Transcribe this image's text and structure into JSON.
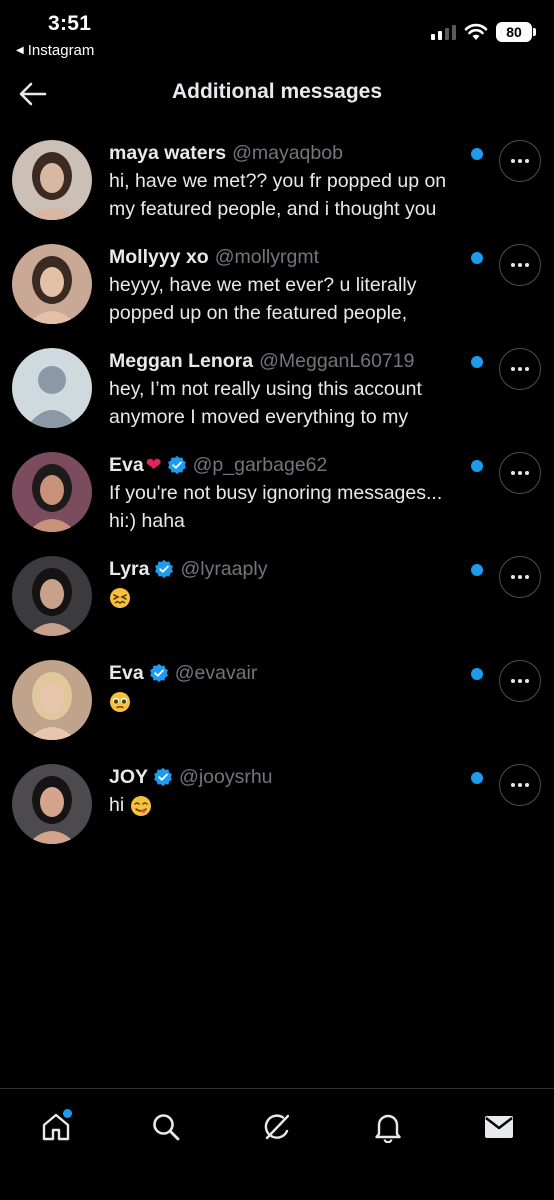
{
  "status_bar": {
    "time": "3:51",
    "back_app": "Instagram",
    "battery": "80"
  },
  "header": {
    "title": "Additional messages"
  },
  "colors": {
    "accent": "#1d9bf0",
    "background": "#000000",
    "text_primary": "#e7e9ea",
    "text_secondary": "#71767b",
    "heart": "#e0245e"
  },
  "conversations": [
    {
      "name": "maya waters",
      "handle": "@mayaqbob",
      "verified": false,
      "heart": "",
      "preview_line1": "hi, have we met?? you fr popped up on",
      "preview_line2": "my featured people, and i thought you",
      "emoji": "",
      "unread": true,
      "avatar_icon": "avatar-photo"
    },
    {
      "name": "Mollyyy xo",
      "handle": "@mollyrgmt",
      "verified": false,
      "heart": "",
      "preview_line1": "heyyy, have we met ever? u literally",
      "preview_line2": "popped up on the featured people,",
      "emoji": "",
      "unread": true,
      "avatar_icon": "avatar-photo"
    },
    {
      "name": "Meggan Lenora",
      "handle": "@MegganL60719",
      "verified": false,
      "heart": "",
      "preview_line1": "hey, I’m not really using this account",
      "preview_line2": "anymore  I moved everything to my",
      "emoji": "",
      "unread": true,
      "avatar_icon": "default-avatar-icon"
    },
    {
      "name": "Eva",
      "handle": "@p_garbage62",
      "verified": true,
      "heart": "❤",
      "preview_line1": "If you're not busy ignoring messages...",
      "preview_line2": "hi:) haha",
      "emoji": "",
      "unread": true,
      "avatar_icon": "avatar-photo"
    },
    {
      "name": "Lyra",
      "handle": "@lyraaply",
      "verified": true,
      "heart": "",
      "preview_line1": "",
      "preview_line2": "",
      "emoji": "confounded-face",
      "unread": true,
      "avatar_icon": "avatar-photo"
    },
    {
      "name": "Eva",
      "handle": "@evavair",
      "verified": true,
      "heart": "",
      "preview_line1": "",
      "preview_line2": "",
      "emoji": "pleading-face",
      "unread": true,
      "avatar_icon": "avatar-photo"
    },
    {
      "name": "JOY",
      "handle": "@jooysrhu",
      "verified": true,
      "heart": "",
      "preview_line1": "hi",
      "preview_line2": "",
      "emoji": "face-savoring",
      "unread": true,
      "avatar_icon": "avatar-photo"
    }
  ],
  "tab_bar": [
    {
      "icon": "home-icon",
      "has_badge": true
    },
    {
      "icon": "search-icon",
      "has_badge": false
    },
    {
      "icon": "grok-icon",
      "has_badge": false
    },
    {
      "icon": "bell-icon",
      "has_badge": false
    },
    {
      "icon": "mail-icon",
      "has_badge": false
    }
  ]
}
